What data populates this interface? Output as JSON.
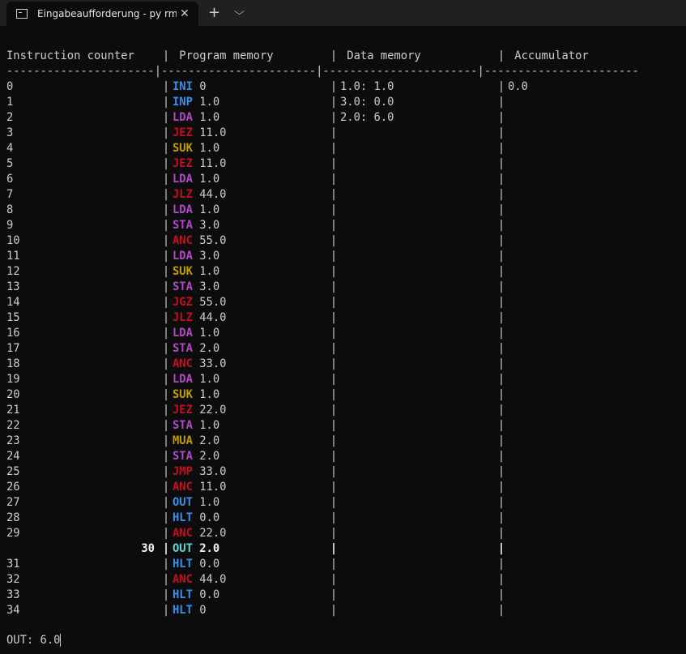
{
  "tab": {
    "title": "Eingabeaufforderung - py  rm_s",
    "close": "✕"
  },
  "toolbar": {
    "new_tab": "+",
    "dropdown": "⌵"
  },
  "header": {
    "c0": "Instruction counter ",
    "c1": " Program memory        ",
    "c2": " Data memory           ",
    "c3": " Accumulator",
    "sep": "|",
    "divider": "----------------------|-----------------------|-----------------------|-----------------------"
  },
  "colors": {
    "blue": "#3b8eea",
    "purple": "#b148c6",
    "red": "#c50f1f",
    "gold": "#c19c00",
    "cyan": "#61d6d6"
  },
  "rows": [
    {
      "n": "0",
      "op": "INI",
      "arg": "0",
      "color": "blue",
      "data": "1.0: 1.0",
      "acc": "0.0"
    },
    {
      "n": "1",
      "op": "INP",
      "arg": "1.0",
      "color": "blue",
      "data": "3.0: 0.0",
      "acc": ""
    },
    {
      "n": "2",
      "op": "LDA",
      "arg": "1.0",
      "color": "purple",
      "data": "2.0: 6.0",
      "acc": ""
    },
    {
      "n": "3",
      "op": "JEZ",
      "arg": "11.0",
      "color": "red",
      "data": "",
      "acc": ""
    },
    {
      "n": "4",
      "op": "SUK",
      "arg": "1.0",
      "color": "gold",
      "data": "",
      "acc": ""
    },
    {
      "n": "5",
      "op": "JEZ",
      "arg": "11.0",
      "color": "red",
      "data": "",
      "acc": ""
    },
    {
      "n": "6",
      "op": "LDA",
      "arg": "1.0",
      "color": "purple",
      "data": "",
      "acc": ""
    },
    {
      "n": "7",
      "op": "JLZ",
      "arg": "44.0",
      "color": "red",
      "data": "",
      "acc": ""
    },
    {
      "n": "8",
      "op": "LDA",
      "arg": "1.0",
      "color": "purple",
      "data": "",
      "acc": ""
    },
    {
      "n": "9",
      "op": "STA",
      "arg": "3.0",
      "color": "purple",
      "data": "",
      "acc": ""
    },
    {
      "n": "10",
      "op": "ANC",
      "arg": "55.0",
      "color": "red",
      "data": "",
      "acc": ""
    },
    {
      "n": "11",
      "op": "LDA",
      "arg": "3.0",
      "color": "purple",
      "data": "",
      "acc": ""
    },
    {
      "n": "12",
      "op": "SUK",
      "arg": "1.0",
      "color": "gold",
      "data": "",
      "acc": ""
    },
    {
      "n": "13",
      "op": "STA",
      "arg": "3.0",
      "color": "purple",
      "data": "",
      "acc": ""
    },
    {
      "n": "14",
      "op": "JGZ",
      "arg": "55.0",
      "color": "red",
      "data": "",
      "acc": ""
    },
    {
      "n": "15",
      "op": "JLZ",
      "arg": "44.0",
      "color": "red",
      "data": "",
      "acc": ""
    },
    {
      "n": "16",
      "op": "LDA",
      "arg": "1.0",
      "color": "purple",
      "data": "",
      "acc": ""
    },
    {
      "n": "17",
      "op": "STA",
      "arg": "2.0",
      "color": "purple",
      "data": "",
      "acc": ""
    },
    {
      "n": "18",
      "op": "ANC",
      "arg": "33.0",
      "color": "red",
      "data": "",
      "acc": ""
    },
    {
      "n": "19",
      "op": "LDA",
      "arg": "1.0",
      "color": "purple",
      "data": "",
      "acc": ""
    },
    {
      "n": "20",
      "op": "SUK",
      "arg": "1.0",
      "color": "gold",
      "data": "",
      "acc": ""
    },
    {
      "n": "21",
      "op": "JEZ",
      "arg": "22.0",
      "color": "red",
      "data": "",
      "acc": ""
    },
    {
      "n": "22",
      "op": "STA",
      "arg": "1.0",
      "color": "purple",
      "data": "",
      "acc": ""
    },
    {
      "n": "23",
      "op": "MUA",
      "arg": "2.0",
      "color": "gold",
      "data": "",
      "acc": ""
    },
    {
      "n": "24",
      "op": "STA",
      "arg": "2.0",
      "color": "purple",
      "data": "",
      "acc": ""
    },
    {
      "n": "25",
      "op": "JMP",
      "arg": "33.0",
      "color": "red",
      "data": "",
      "acc": ""
    },
    {
      "n": "26",
      "op": "ANC",
      "arg": "11.0",
      "color": "red",
      "data": "",
      "acc": ""
    },
    {
      "n": "27",
      "op": "OUT",
      "arg": "1.0",
      "color": "blue",
      "data": "",
      "acc": ""
    },
    {
      "n": "28",
      "op": "HLT",
      "arg": "0.0",
      "color": "blue",
      "data": "",
      "acc": ""
    },
    {
      "n": "29",
      "op": "ANC",
      "arg": "22.0",
      "color": "red",
      "data": "",
      "acc": ""
    },
    {
      "n": "30",
      "op": "OUT",
      "arg": "2.0",
      "color": "cyan",
      "data": "",
      "acc": "",
      "highlight": true
    },
    {
      "n": "31",
      "op": "HLT",
      "arg": "0.0",
      "color": "blue",
      "data": "",
      "acc": ""
    },
    {
      "n": "32",
      "op": "ANC",
      "arg": "44.0",
      "color": "red",
      "data": "",
      "acc": ""
    },
    {
      "n": "33",
      "op": "HLT",
      "arg": "0.0",
      "color": "blue",
      "data": "",
      "acc": ""
    },
    {
      "n": "34",
      "op": "HLT",
      "arg": "0",
      "color": "blue",
      "data": "",
      "acc": ""
    }
  ],
  "output": "OUT: 6.0"
}
